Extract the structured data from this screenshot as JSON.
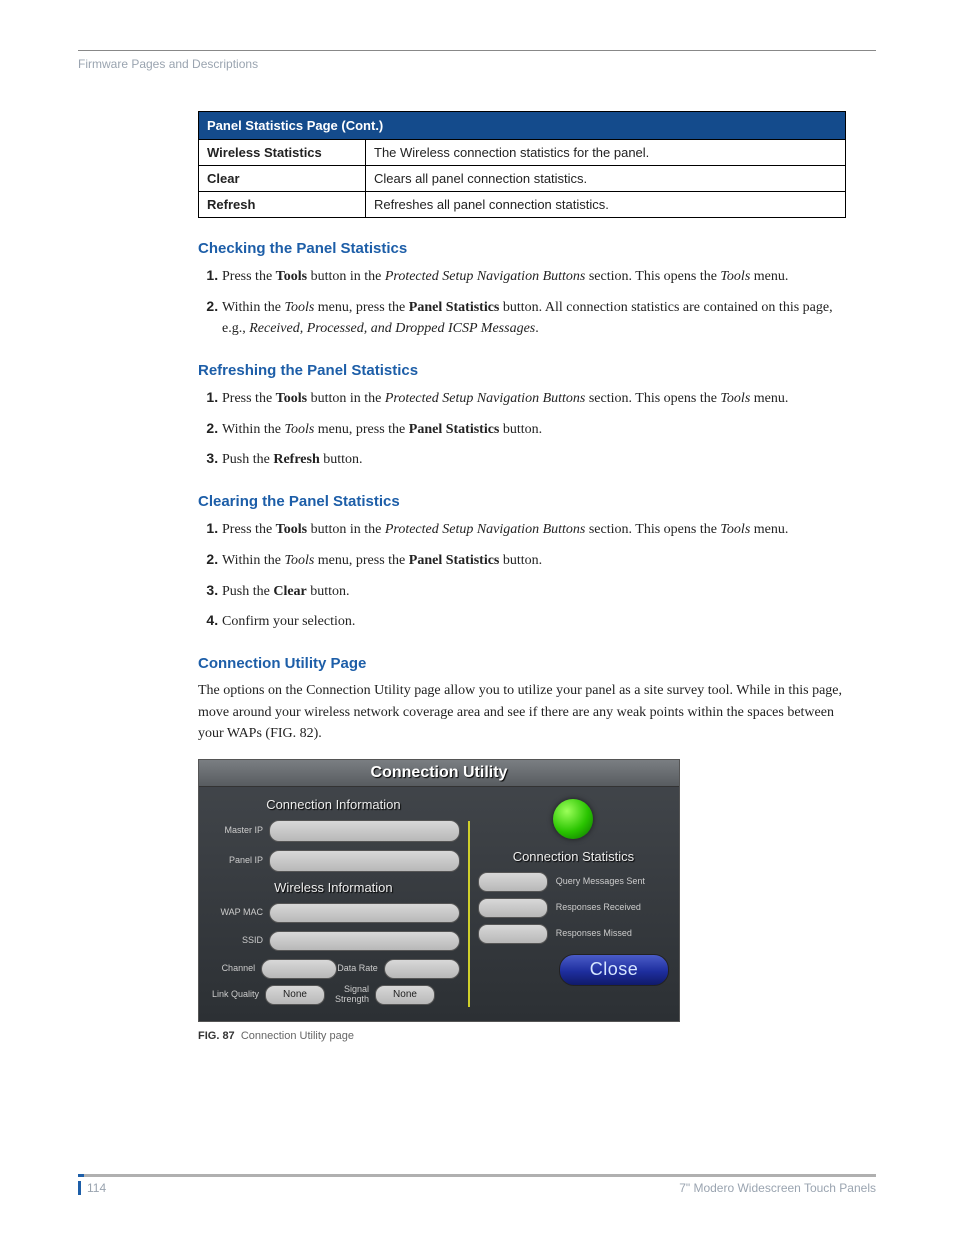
{
  "header": {
    "breadcrumb": "Firmware Pages and Descriptions"
  },
  "table": {
    "title": "Panel Statistics Page (Cont.)",
    "rows": [
      {
        "key": "Wireless Statistics",
        "val": "The Wireless connection statistics for the panel."
      },
      {
        "key": "Clear",
        "val": "Clears all panel connection statistics."
      },
      {
        "key": "Refresh",
        "val": "Refreshes all panel connection statistics."
      }
    ]
  },
  "sections": {
    "checking": {
      "heading": "Checking the Panel Statistics",
      "step1_a": "Press the ",
      "step1_b": "Tools",
      "step1_c": " button in the ",
      "step1_d": "Protected Setup Navigation Buttons",
      "step1_e": " section. This opens the ",
      "step1_f": "Tools",
      "step1_g": " menu.",
      "step2_a": "Within the ",
      "step2_b": "Tools",
      "step2_c": " menu, press the ",
      "step2_d": "Panel Statistics",
      "step2_e": " button. All connection statistics are contained on this page, e.g., ",
      "step2_f": "Received, Processed, and Dropped ICSP Messages",
      "step2_g": "."
    },
    "refreshing": {
      "heading": "Refreshing the Panel Statistics",
      "step1_a": "Press the ",
      "step1_b": "Tools",
      "step1_c": " button in the ",
      "step1_d": "Protected Setup Navigation Buttons",
      "step1_e": " section. This opens the ",
      "step1_f": "Tools",
      "step1_g": " menu.",
      "step2_a": "Within the ",
      "step2_b": "Tools",
      "step2_c": " menu, press the ",
      "step2_d": "Panel Statistics",
      "step2_e": " button.",
      "step3_a": "Push the ",
      "step3_b": "Refresh",
      "step3_c": " button."
    },
    "clearing": {
      "heading": "Clearing the Panel Statistics",
      "step1_a": "Press the ",
      "step1_b": "Tools",
      "step1_c": " button in the ",
      "step1_d": "Protected Setup Navigation Buttons",
      "step1_e": " section. This opens the ",
      "step1_f": "Tools",
      "step1_g": " menu.",
      "step2_a": "Within the ",
      "step2_b": "Tools",
      "step2_c": " menu, press the ",
      "step2_d": "Panel Statistics",
      "step2_e": " button.",
      "step3_a": "Push the ",
      "step3_b": "Clear",
      "step3_c": " button.",
      "step4": "Confirm your selection."
    },
    "conn_util": {
      "heading": "Connection Utility Page",
      "para": "The options on the Connection Utility page allow you to utilize your panel as a site survey tool. While in this page, move around your wireless network coverage area and see if there are any weak points within the spaces between your WAPs (FIG. 82)."
    }
  },
  "panel": {
    "title": "Connection Utility",
    "left_head1": "Connection Information",
    "left_head2": "Wireless Information",
    "labels": {
      "master_ip": "Master IP",
      "panel_ip": "Panel IP",
      "wap_mac": "WAP MAC",
      "ssid": "SSID",
      "channel": "Channel",
      "data_rate": "Data Rate",
      "link_quality": "Link Quality",
      "signal_strength": "Signal Strength"
    },
    "values": {
      "link_quality": "None",
      "signal_strength": "None"
    },
    "right_head": "Connection Statistics",
    "stats": {
      "query": "Query Messages Sent",
      "resp_recv": "Responses Received",
      "resp_missed": "Responses Missed"
    },
    "close": "Close"
  },
  "figure": {
    "num": "FIG. 87",
    "caption": "Connection Utility page"
  },
  "footer": {
    "page": "114",
    "title": "7\" Modero Widescreen Touch Panels"
  }
}
